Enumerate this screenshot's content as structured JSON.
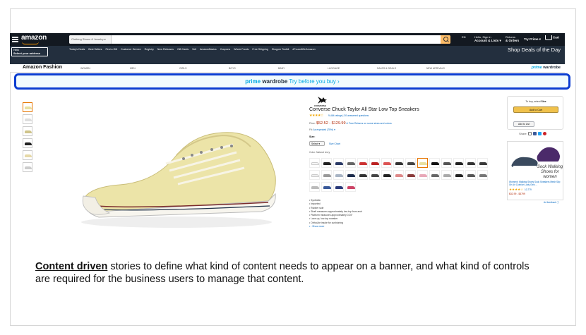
{
  "nav": {
    "logo": "amazon",
    "search_category": "Clothing Shoes & Jewelry ▾",
    "flag_label": "EN",
    "account_line1": "Hello, Sign in",
    "account_line2": "Account & Lists ▾",
    "orders_line1": "Returns",
    "orders_line2": "& Orders",
    "prime_label": "Try Prime ▾",
    "cart_count": "0",
    "cart_label": "Cart",
    "address_line1": "Hello",
    "address_line2": "Select your address",
    "links": [
      "Today's Deals",
      "Best Sellers",
      "Find a Gift",
      "Customer Service",
      "Registry",
      "New Releases",
      "Gift Cards",
      "Sell",
      "AmazonBasics",
      "Coupons",
      "Whole Foods",
      "Free Shipping",
      "Shopper Toolkit",
      "#FoundItOnAmazon"
    ],
    "deals_label": "Shop Deals of the Day"
  },
  "fashion": {
    "title": "Amazon Fashion",
    "links": [
      "WOMEN",
      "MEN",
      "GIRLS",
      "BOYS",
      "BABY",
      "LUGGAGE",
      "SALES & DEALS",
      "NEW ARRIVALS"
    ],
    "prime_word": "prime",
    "wardrobe_word": "wardrobe"
  },
  "banner": {
    "prime_word": "prime",
    "wardrobe_word": "wardrobe",
    "cta": "Try before you buy ›"
  },
  "product": {
    "brand": "CONVERSE",
    "title": "Converse Chuck Taylor All Star Low Top Sneakers",
    "stars": "★★★★☆",
    "rating_text": "9,464 ratings | 30 answered questions",
    "price_label": "Price:",
    "price": "$52.52 - $129.99",
    "price_note": "& Free Returns on some sizes and colors",
    "fit_label": "Fit:",
    "fit_value": "As expected (75%) ▾",
    "size_label": "Size:",
    "size_select": "Select ▾",
    "size_chart": "Size Chart",
    "color_label": "Color: Natural Ivory",
    "bullets": [
      "Synthetic",
      "Imported",
      "Rubber sole",
      "Shaft measures approximately low-top from arch",
      "Platform measures approximately 0.25\"",
      "Lace-up, low-top sneaker",
      "OrthoLite insole for cushioning"
    ],
    "show_more": "› Show more"
  },
  "buybox": {
    "select_prefix": "To buy, select",
    "select_bold": "Size",
    "add_to_cart": "Add to Cart",
    "add_to_list": "Add to List",
    "share_label": "Share"
  },
  "ad": {
    "headline": "Sock Walking Shoes for women",
    "description": "Women's Walking Shoes Sock Sneakers Mesh Slip On Air Cushion Lady Girls ...",
    "stars": "★★★★☆",
    "count": "10,779",
    "price": "$32.99 - $3799",
    "feedback": "Ad feedback ⓘ"
  },
  "caption": {
    "strong": "Content driven",
    "rest": " stories to define what kind of content needs to appear on a banner, and what kind of controls are required for the business users to manage that content."
  },
  "colors": {
    "nav_dark": "#131921",
    "nav_sub": "#232f3e",
    "prime_blue": "#00a8e1",
    "highlight_border": "#0b3dd1",
    "price_red": "#b12704",
    "cart_yellow": "#f0c14b"
  }
}
